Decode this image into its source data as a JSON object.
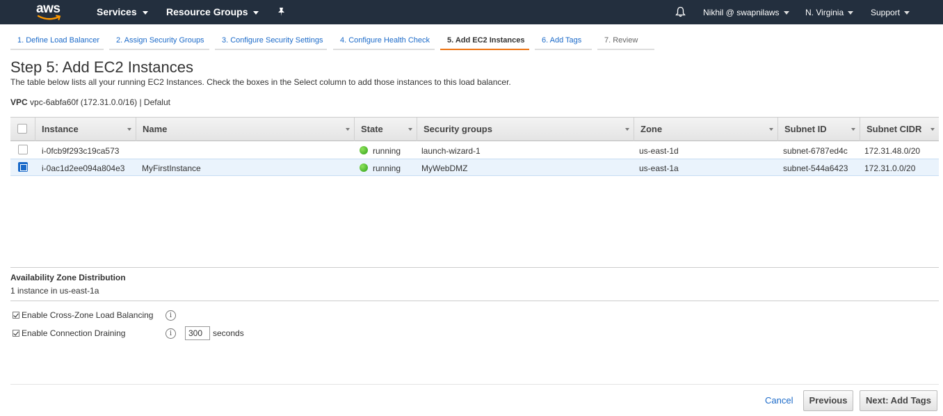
{
  "topnav": {
    "logo_text": "aws",
    "services": "Services",
    "resource_groups": "Resource Groups",
    "user": "Nikhil @ swapnilaws",
    "region": "N. Virginia",
    "support": "Support",
    "icons": [
      "pin-icon",
      "bell-icon"
    ]
  },
  "tabs": [
    {
      "label": "1. Define Load Balancer",
      "state": "done"
    },
    {
      "label": "2. Assign Security Groups",
      "state": "done"
    },
    {
      "label": "3. Configure Security Settings",
      "state": "done"
    },
    {
      "label": "4. Configure Health Check",
      "state": "done"
    },
    {
      "label": "5. Add EC2 Instances",
      "state": "active"
    },
    {
      "label": "6. Add Tags",
      "state": "next"
    },
    {
      "label": "7. Review",
      "state": "future"
    }
  ],
  "page": {
    "title": "Step 5: Add EC2 Instances",
    "description": "The table below lists all your running EC2 Instances. Check the boxes in the Select column to add those instances to this load balancer.",
    "vpc_label": "VPC",
    "vpc_value": "vpc-6abfa60f (172.31.0.0/16) | Defalut"
  },
  "table": {
    "columns": [
      "Instance",
      "Name",
      "State",
      "Security groups",
      "Zone",
      "Subnet ID",
      "Subnet CIDR"
    ],
    "rows": [
      {
        "selected": false,
        "instance": "i-0fcb9f293c19ca573",
        "name": "",
        "state": "running",
        "security_groups": "launch-wizard-1",
        "zone": "us-east-1d",
        "subnet_id": "subnet-6787ed4c",
        "subnet_cidr": "172.31.48.0/20"
      },
      {
        "selected": true,
        "instance": "i-0ac1d2ee094a804e3",
        "name": "MyFirstInstance",
        "state": "running",
        "security_groups": "MyWebDMZ",
        "zone": "us-east-1a",
        "subnet_id": "subnet-544a6423",
        "subnet_cidr": "172.31.0.0/20"
      }
    ]
  },
  "az": {
    "title": "Availability Zone Distribution",
    "summary": "1 instance in us-east-1a"
  },
  "options": {
    "cross_zone": {
      "label": "Enable Cross-Zone Load Balancing",
      "checked": true
    },
    "draining": {
      "label": "Enable Connection Draining",
      "checked": true,
      "value": "300",
      "unit": "seconds"
    }
  },
  "footer": {
    "cancel": "Cancel",
    "previous": "Previous",
    "next": "Next: Add Tags"
  },
  "colors": {
    "nav_bg": "#232f3e",
    "accent": "#ec7211",
    "link": "#1b6ac9",
    "running": "#2ea01a"
  }
}
